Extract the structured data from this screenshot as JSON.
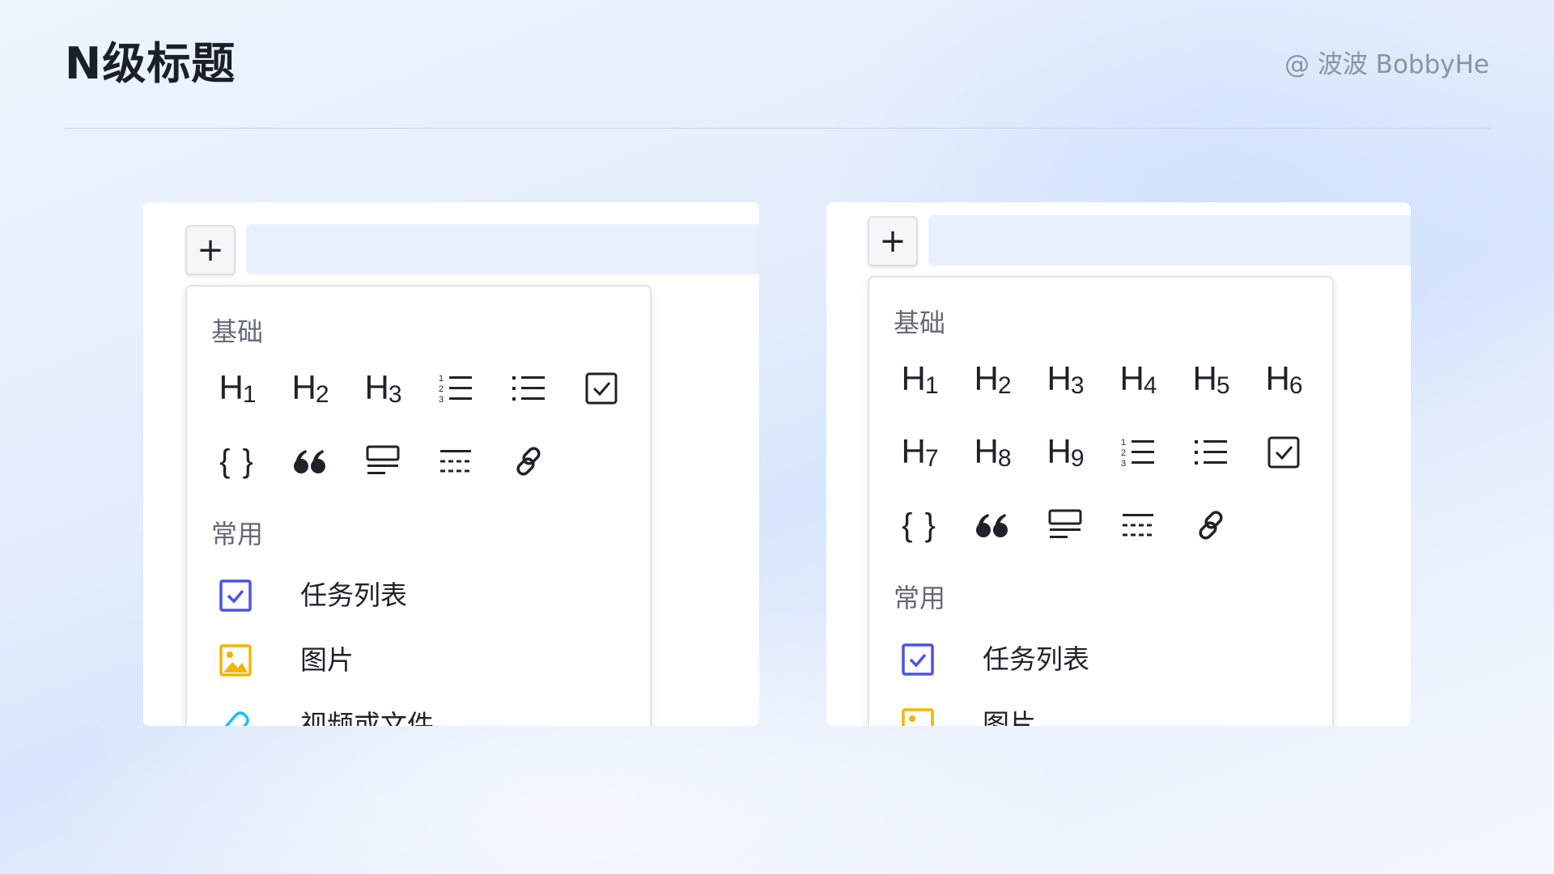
{
  "header": {
    "title": "N级标题",
    "author": "@ 波波 BobbyHe"
  },
  "left_panel": {
    "plus_label": "+",
    "sections": {
      "basic": "基础",
      "common": "常用"
    },
    "toolbar": [
      {
        "name": "heading-1",
        "icon": "heading-icon",
        "letter": "H",
        "level": "1"
      },
      {
        "name": "heading-2",
        "icon": "heading-icon",
        "letter": "H",
        "level": "2"
      },
      {
        "name": "heading-3",
        "icon": "heading-icon",
        "letter": "H",
        "level": "3"
      },
      {
        "name": "ordered-list",
        "icon": "ordered-list-icon"
      },
      {
        "name": "bullet-list",
        "icon": "bullet-list-icon"
      },
      {
        "name": "checkbox",
        "icon": "checkbox-icon"
      },
      {
        "name": "code-block",
        "icon": "code-braces-icon",
        "glyph": "{ }"
      },
      {
        "name": "quote",
        "icon": "quote-icon"
      },
      {
        "name": "callout",
        "icon": "callout-icon"
      },
      {
        "name": "divider",
        "icon": "divider-icon"
      },
      {
        "name": "link",
        "icon": "link-icon"
      }
    ],
    "common_items": [
      {
        "label": "任务列表",
        "icon": "task-list-icon",
        "color": "#4954e6"
      },
      {
        "label": "图片",
        "icon": "image-icon",
        "color": "#f5b400"
      },
      {
        "label": "视频或文件",
        "icon": "attachment-icon",
        "color": "#14c0ff"
      }
    ]
  },
  "right_panel": {
    "plus_label": "+",
    "sections": {
      "basic": "基础",
      "common": "常用"
    },
    "headings": [
      {
        "letter": "H",
        "level": "1"
      },
      {
        "letter": "H",
        "level": "2"
      },
      {
        "letter": "H",
        "level": "3"
      },
      {
        "letter": "H",
        "level": "4"
      },
      {
        "letter": "H",
        "level": "5"
      },
      {
        "letter": "H",
        "level": "6"
      },
      {
        "letter": "H",
        "level": "7"
      },
      {
        "letter": "H",
        "level": "8"
      },
      {
        "letter": "H",
        "level": "9"
      }
    ],
    "code_glyph": "{ }",
    "common_items": [
      {
        "label": "任务列表",
        "icon": "task-list-icon",
        "color": "#4954e6"
      },
      {
        "label": "图片",
        "icon": "image-icon",
        "color": "#f5b400"
      }
    ]
  },
  "colors": {
    "task_blue": "#4954e6",
    "image_yellow": "#f5b400",
    "attachment_cyan": "#14c0ff",
    "input_bar": "#e8effd",
    "title_text": "#1b1f27",
    "author_text": "#8c93a0"
  }
}
